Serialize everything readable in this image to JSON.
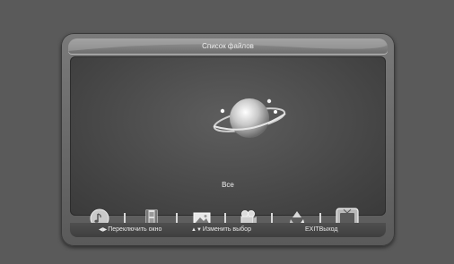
{
  "window": {
    "title": "Список файлов"
  },
  "category": {
    "label": "Все"
  },
  "media_types": [
    {
      "name": "music-icon"
    },
    {
      "name": "video-icon"
    },
    {
      "name": "photo-icon"
    },
    {
      "name": "camera-icon"
    },
    {
      "name": "recycle-icon"
    },
    {
      "name": "tv-icon",
      "selected": true
    }
  ],
  "footer": {
    "hint1_key": "◀▶",
    "hint1_label": "Переключить окно",
    "hint2_key": "▲▼",
    "hint2_label": "Изменить выбор",
    "hint3_key": "EXIT",
    "hint3_label": "Выход"
  },
  "colors": {
    "background": "#5a5a5a",
    "frame": "#6e6e6e",
    "text": "#f0f0f0"
  }
}
